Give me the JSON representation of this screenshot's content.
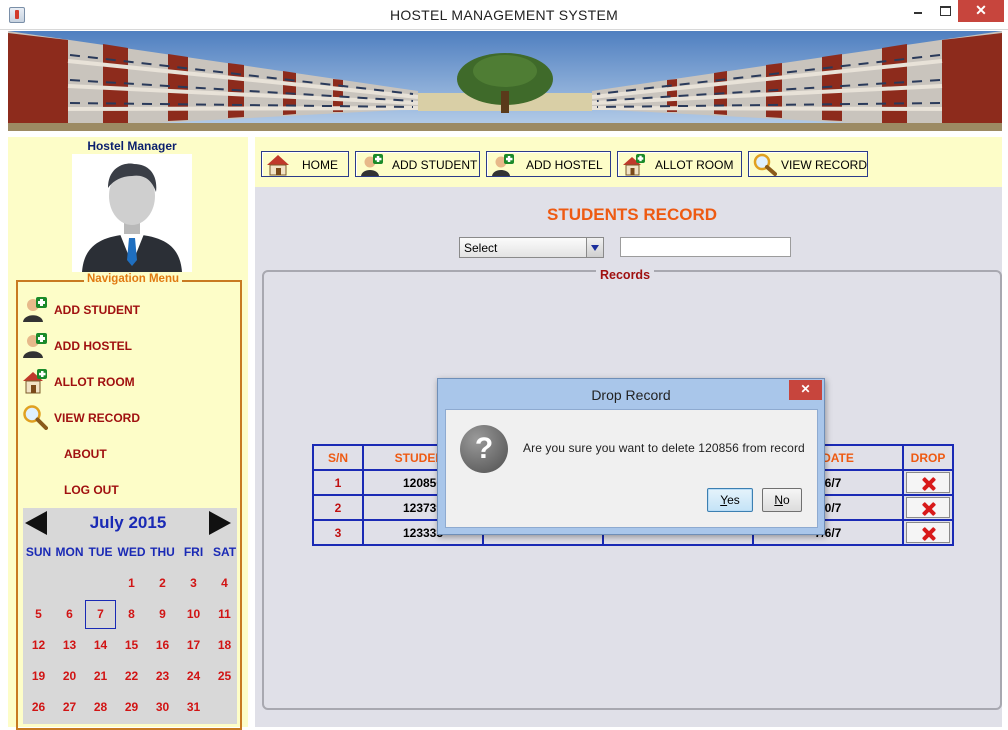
{
  "window": {
    "title": "HOSTEL MANAGEMENT SYSTEM",
    "app_icon": "java-cup-icon",
    "controls": [
      "minimize-icon",
      "maximize-icon",
      "close-icon"
    ],
    "close_glyph": "✕"
  },
  "sidebar": {
    "title": "Hostel Manager",
    "nav_legend": "Navigation Menu",
    "items": [
      {
        "label": "ADD STUDENT",
        "icon": "add-user-icon"
      },
      {
        "label": "ADD HOSTEL",
        "icon": "add-user-icon"
      },
      {
        "label": "ALLOT ROOM",
        "icon": "house-add-icon"
      },
      {
        "label": "VIEW RECORD",
        "icon": "magnifier-icon"
      },
      {
        "label": "ABOUT",
        "icon": null
      },
      {
        "label": "LOG OUT",
        "icon": null
      }
    ]
  },
  "calendar": {
    "month": "July 2015",
    "weekdays": [
      "SUN",
      "MON",
      "TUE",
      "WED",
      "THU",
      "FRI",
      "SAT"
    ],
    "weeks": [
      [
        "",
        "",
        "",
        "1",
        "2",
        "3",
        "4"
      ],
      [
        "5",
        "6",
        "7",
        "8",
        "9",
        "10",
        "11"
      ],
      [
        "12",
        "13",
        "14",
        "15",
        "16",
        "17",
        "18"
      ],
      [
        "19",
        "20",
        "21",
        "22",
        "23",
        "24",
        "25"
      ],
      [
        "26",
        "27",
        "28",
        "29",
        "30",
        "31",
        ""
      ]
    ],
    "selected_day": "7",
    "accent_color": "#1a2ab5",
    "day_color": "#d11414"
  },
  "toolbar": {
    "buttons": [
      {
        "label": "HOME",
        "icon": "house-icon"
      },
      {
        "label": "ADD STUDENT",
        "icon": "add-user-icon"
      },
      {
        "label": "ADD HOSTEL",
        "icon": "add-user-icon"
      },
      {
        "label": "ALLOT ROOM",
        "icon": "house-add-icon"
      },
      {
        "label": "VIEW RECORD",
        "icon": "magnifier-icon"
      }
    ]
  },
  "main": {
    "title": "STUDENTS RECORD",
    "filter_select": {
      "value": "Select"
    },
    "search_value": "",
    "records_legend": "Records"
  },
  "table": {
    "headers": [
      "S/N",
      "STUDENT",
      "",
      "",
      "UE DATE",
      "DROP"
    ],
    "rows": [
      {
        "sn": "1",
        "student": "120856",
        "due": "6/6/7"
      },
      {
        "sn": "2",
        "student": "123739",
        "due": "6/0/7"
      },
      {
        "sn": "3",
        "student": "123333",
        "due": "7/6/7"
      }
    ],
    "drop_icon": "red-x-icon"
  },
  "dialog": {
    "title": "Drop Record",
    "message": "Are you sure you want to delete 120856 from record",
    "icon": "question-icon",
    "icon_glyph": "?",
    "yes": {
      "mnemonic": "Y",
      "rest": "es"
    },
    "no": {
      "mnemonic": "N",
      "rest": "o"
    }
  },
  "colors": {
    "panel_yellow": "#fdfdc8",
    "nav_red": "#a01010",
    "title_orange": "#ee5a12",
    "content_gray": "#e0e0e8"
  }
}
